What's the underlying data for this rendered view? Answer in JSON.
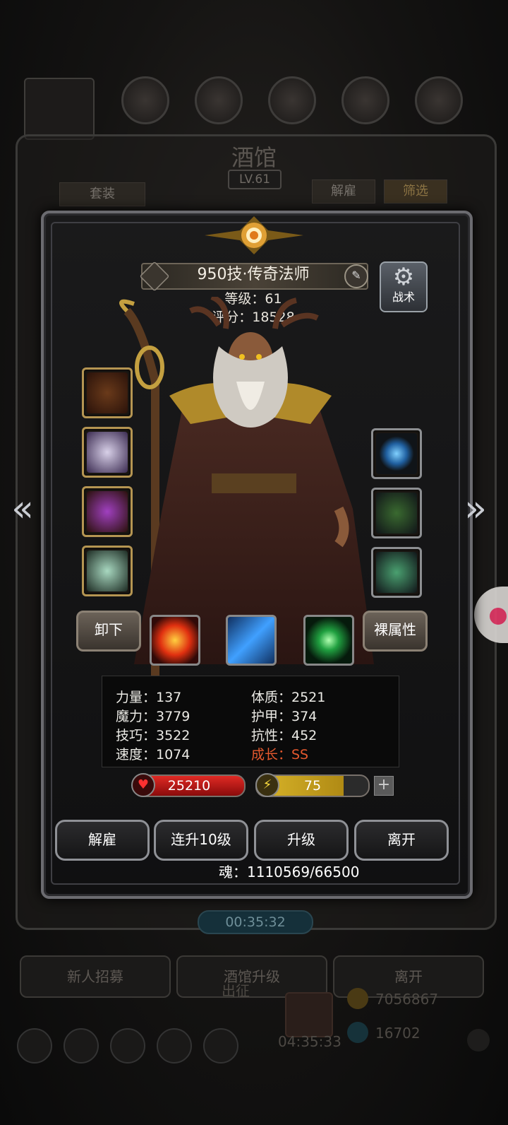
{
  "background": {
    "tavern_title": "酒馆",
    "tavern_level": "LV.61",
    "set_button": "套装",
    "dismiss_tab": "解雇",
    "filter_tab": "筛选",
    "timer": "00:35:32",
    "bottom_buttons": [
      "新人招募",
      "酒馆升级",
      "离开"
    ],
    "expedition_label": "出征",
    "gold_amount": "7056867",
    "gem_amount": "16702",
    "countdown": "04:35:33"
  },
  "hero": {
    "name": "950技·传奇法师",
    "level_label": "等级：61",
    "score_label": "评分：18528",
    "tactics_label": "战术",
    "unequip_label": "卸下",
    "base_stats_label": "裸属性"
  },
  "equipment": {
    "left": [
      "staff-weapon",
      "white-robe-armor",
      "purple-amulet",
      "jade-ring"
    ],
    "right": [
      "blue-orb",
      "green-staff",
      "jade-token"
    ]
  },
  "skills": [
    "fire-blast-skill",
    "ice-shard-skill",
    "nature-heal-skill"
  ],
  "stats": {
    "col1": [
      "力量：137",
      "魔力：3779",
      "技巧：3522",
      "速度：1074"
    ],
    "col2": [
      "体质：2521",
      "护甲：374",
      "抗性：452",
      "成长：SS"
    ]
  },
  "bars": {
    "hp": "25210",
    "energy": "75",
    "energy_fill_fraction": 0.78
  },
  "actions": [
    "解雇",
    "连升10级",
    "升级",
    "离开"
  ],
  "soul": "魂：1110569/66500",
  "colors": {
    "growth": "#e5592e",
    "hp": "#e02a24",
    "energy": "#d9b52a",
    "gold_frame": "#b59552"
  }
}
